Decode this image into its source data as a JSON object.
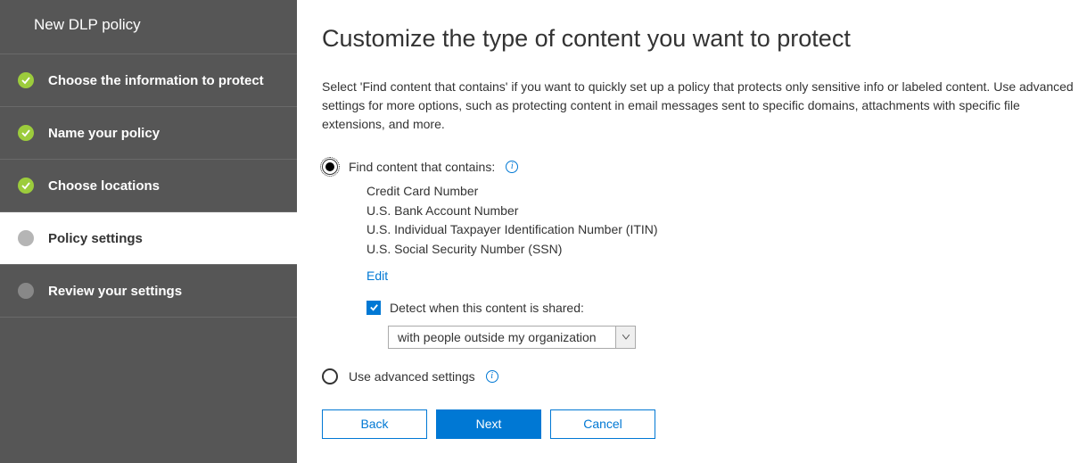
{
  "sidebar": {
    "title": "New DLP policy",
    "steps": [
      {
        "label": "Choose the information to protect",
        "status": "completed"
      },
      {
        "label": "Name your policy",
        "status": "completed"
      },
      {
        "label": "Choose locations",
        "status": "completed"
      },
      {
        "label": "Policy settings",
        "status": "active"
      },
      {
        "label": "Review your settings",
        "status": "pending"
      }
    ]
  },
  "main": {
    "title": "Customize the type of content you want to protect",
    "description": "Select 'Find content that contains' if you want to quickly set up a policy that protects only sensitive info or labeled content. Use advanced settings for more options, such as protecting content in email messages sent to specific domains, attachments with specific file extensions, and more.",
    "option_find": {
      "label": "Find content that contains:",
      "items": [
        "Credit Card Number",
        "U.S. Bank Account Number",
        "U.S. Individual Taxpayer Identification Number (ITIN)",
        "U.S. Social Security Number (SSN)"
      ],
      "edit_label": "Edit",
      "detect_label": "Detect when this content is shared:",
      "detect_select": "with people outside my organization"
    },
    "option_advanced": {
      "label": "Use advanced settings"
    },
    "buttons": {
      "back": "Back",
      "next": "Next",
      "cancel": "Cancel"
    }
  }
}
